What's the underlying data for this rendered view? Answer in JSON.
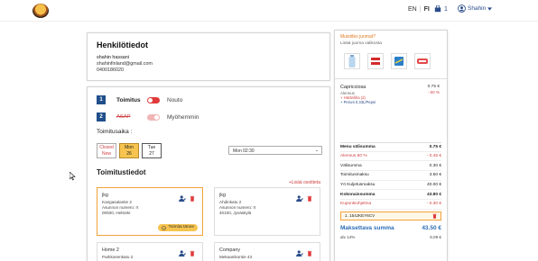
{
  "header": {
    "lang_en": "EN",
    "lang_sep": "|",
    "lang_fi": "FI",
    "cart_count": "1",
    "user_name": "Shahin",
    "colors": {
      "brand": "#204f8c",
      "accent": "#e03a3a",
      "highlight": "#f6c44f"
    }
  },
  "person": {
    "title": "Henkilötiedot",
    "name": "shahin hassani",
    "email": "shahinfinland@gmail.com",
    "phone": "0400186020"
  },
  "order": {
    "step1": {
      "num": "1",
      "opt_a": "Toimitus",
      "opt_b": "Nouto"
    },
    "step2": {
      "num": "2",
      "opt_a": "ASAP",
      "opt_b": "Myöhemmin"
    },
    "time_label": "Toimitusaika :",
    "days": [
      {
        "line1": "Closed",
        "line2": "Now",
        "state": "closed"
      },
      {
        "line1": "Mon",
        "line2": "26",
        "state": "selected"
      },
      {
        "line1": "Tue",
        "line2": "27",
        "state": "normal"
      }
    ],
    "time_value": "Mon 02:30",
    "delivery_title": "Toimitustiedot",
    "add_address": "+Lisää osoitteta",
    "addresses": [
      {
        "title": "jkg",
        "line1": "Kangasalantie 2",
        "line2": "Asunnon numero: rt",
        "line3": "00930, Helsinki",
        "chip": "Toimita tänne"
      },
      {
        "title": "jkg",
        "line1": "Ahdinkatu 2",
        "line2": "Asunnon numero: rt",
        "line3": "40100, Jyväskylä"
      },
      {
        "title": "Home 2",
        "line1": "Parkkosenkatu 2"
      },
      {
        "title": "Company",
        "line1": "Mekaanikontie 43"
      }
    ]
  },
  "sidebar": {
    "question": "Muistitko juomat?",
    "subtitle": "Lisää juoma valikosta",
    "drinks": [
      "water-bottle-icon",
      "cola-can-icon",
      "soda-can-icon",
      "coca-cola-bottle-icon"
    ],
    "item": {
      "name": "Capricciosa",
      "price": "0.75 €",
      "discount_label": "Alennus",
      "discount_value": "- 60 %",
      "extra_red": "+ Häränliha (2)",
      "extra_blue": "+ Peruni 0.33L/Pepsi"
    },
    "totals": [
      {
        "label": "Menu välisumma",
        "value": "0.75 €",
        "style": "bold"
      },
      {
        "label": "Alennus 60 %",
        "value": "- 0.45 €",
        "style": "red"
      },
      {
        "label": "Välisumma",
        "value": "0.30 €",
        "style": ""
      },
      {
        "label": "Toimitusmaksu",
        "value": "3.50 €",
        "style": ""
      },
      {
        "label": "Yö Kuljetusmaksu",
        "value": "40.00 €",
        "style": ""
      },
      {
        "label": "Kokonaissumma",
        "value": "43.80 €",
        "style": "bold"
      },
      {
        "label": "Kuponkiohjelma",
        "value": "- 0.30 €",
        "style": "red"
      }
    ],
    "coupon_code": "1. 154JKEY6CV",
    "pay_label": "Maksettava summa",
    "pay_value": "43.50 €",
    "vat_label": "alv 14%",
    "vat_value": "6.09 €"
  }
}
